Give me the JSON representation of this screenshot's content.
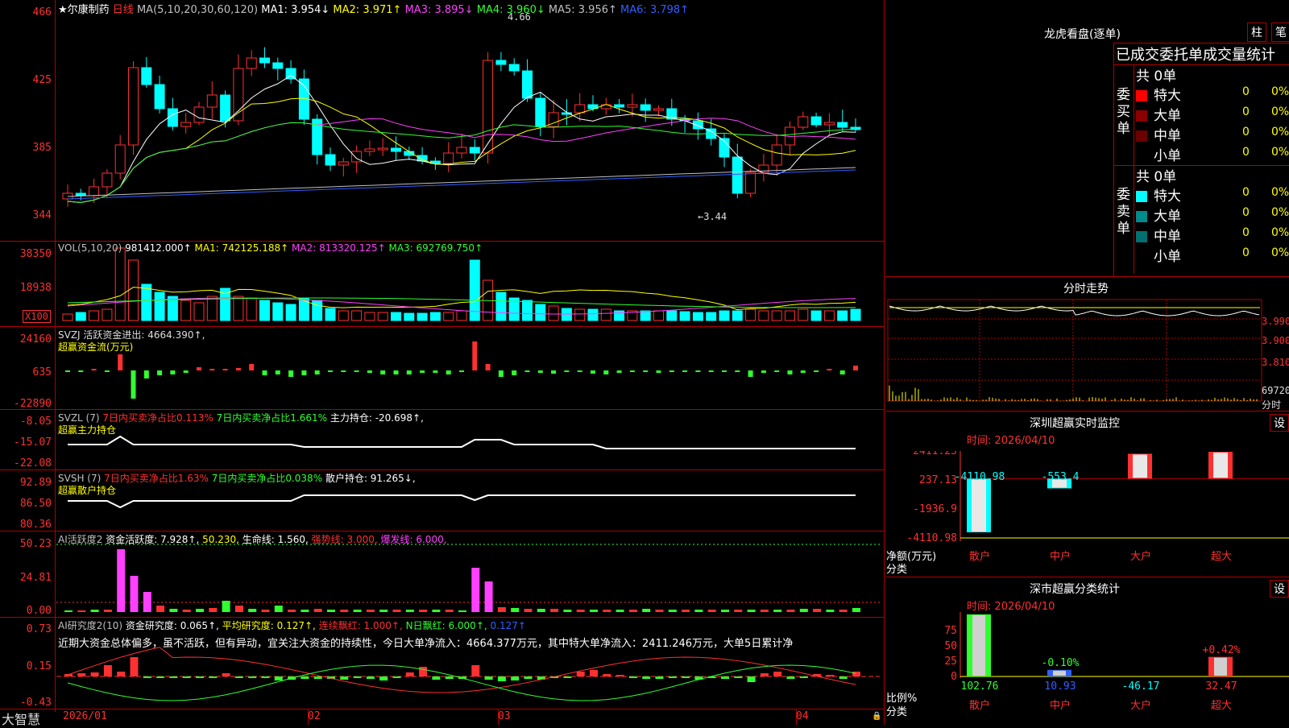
{
  "colors": {
    "up": "#ff3030",
    "down": "#00ffff",
    "grid": "#b00000",
    "bg": "#000000"
  },
  "main": {
    "stock": "★尔康制药",
    "period": "日线",
    "ma_label": "MA(5,10,20,30,60,120)",
    "ma1": "MA1: 3.954↓",
    "ma2": "MA2: 3.971↑",
    "ma3": "MA3: 3.895↓",
    "ma4": "MA4: 3.960↓",
    "ma5": "MA5: 3.956↑",
    "ma6": "MA6: 3.798↑",
    "high_mark": "4.66",
    "low_mark": "←3.44",
    "yaxis": [
      "466",
      "425",
      "385",
      "344"
    ]
  },
  "vol": {
    "label": "VOL(5,10,20)",
    "v": "981412.000↑",
    "ma1": "MA1: 742125.188↑",
    "ma2": "MA2: 813320.125↑",
    "ma3": "MA3: 692769.750↑",
    "yaxis": [
      "38350",
      "18938"
    ],
    "unit": "X100"
  },
  "svzj": {
    "label": "SVZJ  活跃资金进出: 4664.390↑,",
    "sub": "超赢资金流(万元)",
    "yaxis": [
      "24160",
      "635",
      "-22890"
    ]
  },
  "svzl": {
    "label": "SVZL (7)",
    "t1": "7日内买卖净占比0.113%",
    "t2": "7日内买卖净占比1.661%",
    "t3": "主力持仓: -20.698↑,",
    "sub": "超赢主力持仓",
    "yaxis": [
      "-8.05",
      "-15.07",
      "-22.08"
    ]
  },
  "svsh": {
    "label": "SVSH (7)",
    "t1": "7日内买卖净占比1.63%",
    "t2": "7日内买卖净占比0.038%",
    "t3": "散户持仓: 91.265↓,",
    "sub": "超赢散户持仓",
    "yaxis": [
      "92.89",
      "86.50",
      "80.36"
    ]
  },
  "ai2": {
    "label": "AI活跃度2",
    "t1": "资金活跃度: 7.928↑,",
    "t2": "50.230,",
    "t3": "生命线: 1.560,",
    "t4": "强势线: 3.000,",
    "t5": "爆发线: 6.000,",
    "yaxis": [
      "50.23",
      "24.81",
      "0.00"
    ]
  },
  "ai10": {
    "label": "AI研究度2(10)",
    "t1": "资金研究度: 0.065↑,",
    "t2": "平均研究度: 0.127↑,",
    "t3": "连续飘红: 1.000↑,",
    "t4": "N日飘红: 6.000↑,",
    "t5": "0.127↑",
    "comment": "近期大资金总体偏多，虽不活跃，但有异动，宜关注大资金的持续性，今日大单净流入：4664.377万元，其中特大单净流入：2411.246万元，大单5日累计净",
    "yaxis": [
      "0.73",
      "0.15",
      "-0.43"
    ]
  },
  "xaxis": {
    "brand": "大智慧",
    "labels": [
      "2026/01",
      "02",
      "03",
      "04"
    ]
  },
  "lhb": {
    "title": "龙虎看盘(逐单)",
    "btn1": "柱",
    "btn2": "笔",
    "header": "已成交委托单成交量统计",
    "buy_label": "委买单",
    "sell_label": "委卖单",
    "buy_total": "共 0单",
    "sell_total": "共 0单",
    "rows": [
      {
        "name": "特大",
        "val": "0",
        "pct": "0%"
      },
      {
        "name": "大单",
        "val": "0",
        "pct": "0%"
      },
      {
        "name": "中单",
        "val": "0",
        "pct": "0%"
      },
      {
        "name": "小单",
        "val": "0",
        "pct": "0%"
      }
    ]
  },
  "intraday": {
    "title": "分时走势",
    "prices": [
      "3.990",
      "3.900",
      "3.810"
    ],
    "vol": "69720",
    "unit": "分时"
  },
  "sz_monitor": {
    "title": "深圳超赢实时监控",
    "btn": "设",
    "time": "时间: 2026/04/10",
    "yaxis": [
      "2411.25",
      "237.13",
      "-1936.9",
      "-4110.98"
    ],
    "ylabel": "净额(万元)",
    "xlabel": "分类",
    "cats": [
      "散户",
      "中户",
      "大户",
      "超大"
    ],
    "values": [
      "-4110.98",
      "-553.4",
      "2253.13",
      "2411.25"
    ]
  },
  "sz_stats": {
    "title": "深市超赢分类统计",
    "btn": "设",
    "time": "时间: 2026/04/10",
    "yaxis": [
      "75",
      "50",
      "25",
      "0"
    ],
    "ylabel": "比例%",
    "xlabel": "分类",
    "cats": [
      "散户",
      "中户",
      "大户",
      "超大"
    ],
    "values": [
      "102.76",
      "10.93",
      "-46.17",
      "32.47"
    ],
    "top_labels": [
      "-0.10%",
      "+0.42%"
    ]
  },
  "chart_data": {
    "type": "bar",
    "categories": [
      "散户",
      "中户",
      "大户",
      "超大"
    ],
    "values": [
      -4110.98,
      -553.4,
      2253.13,
      2411.25
    ],
    "ylim": [
      -4110.98,
      2411.25
    ],
    "ylabel": "净额(万元)"
  }
}
